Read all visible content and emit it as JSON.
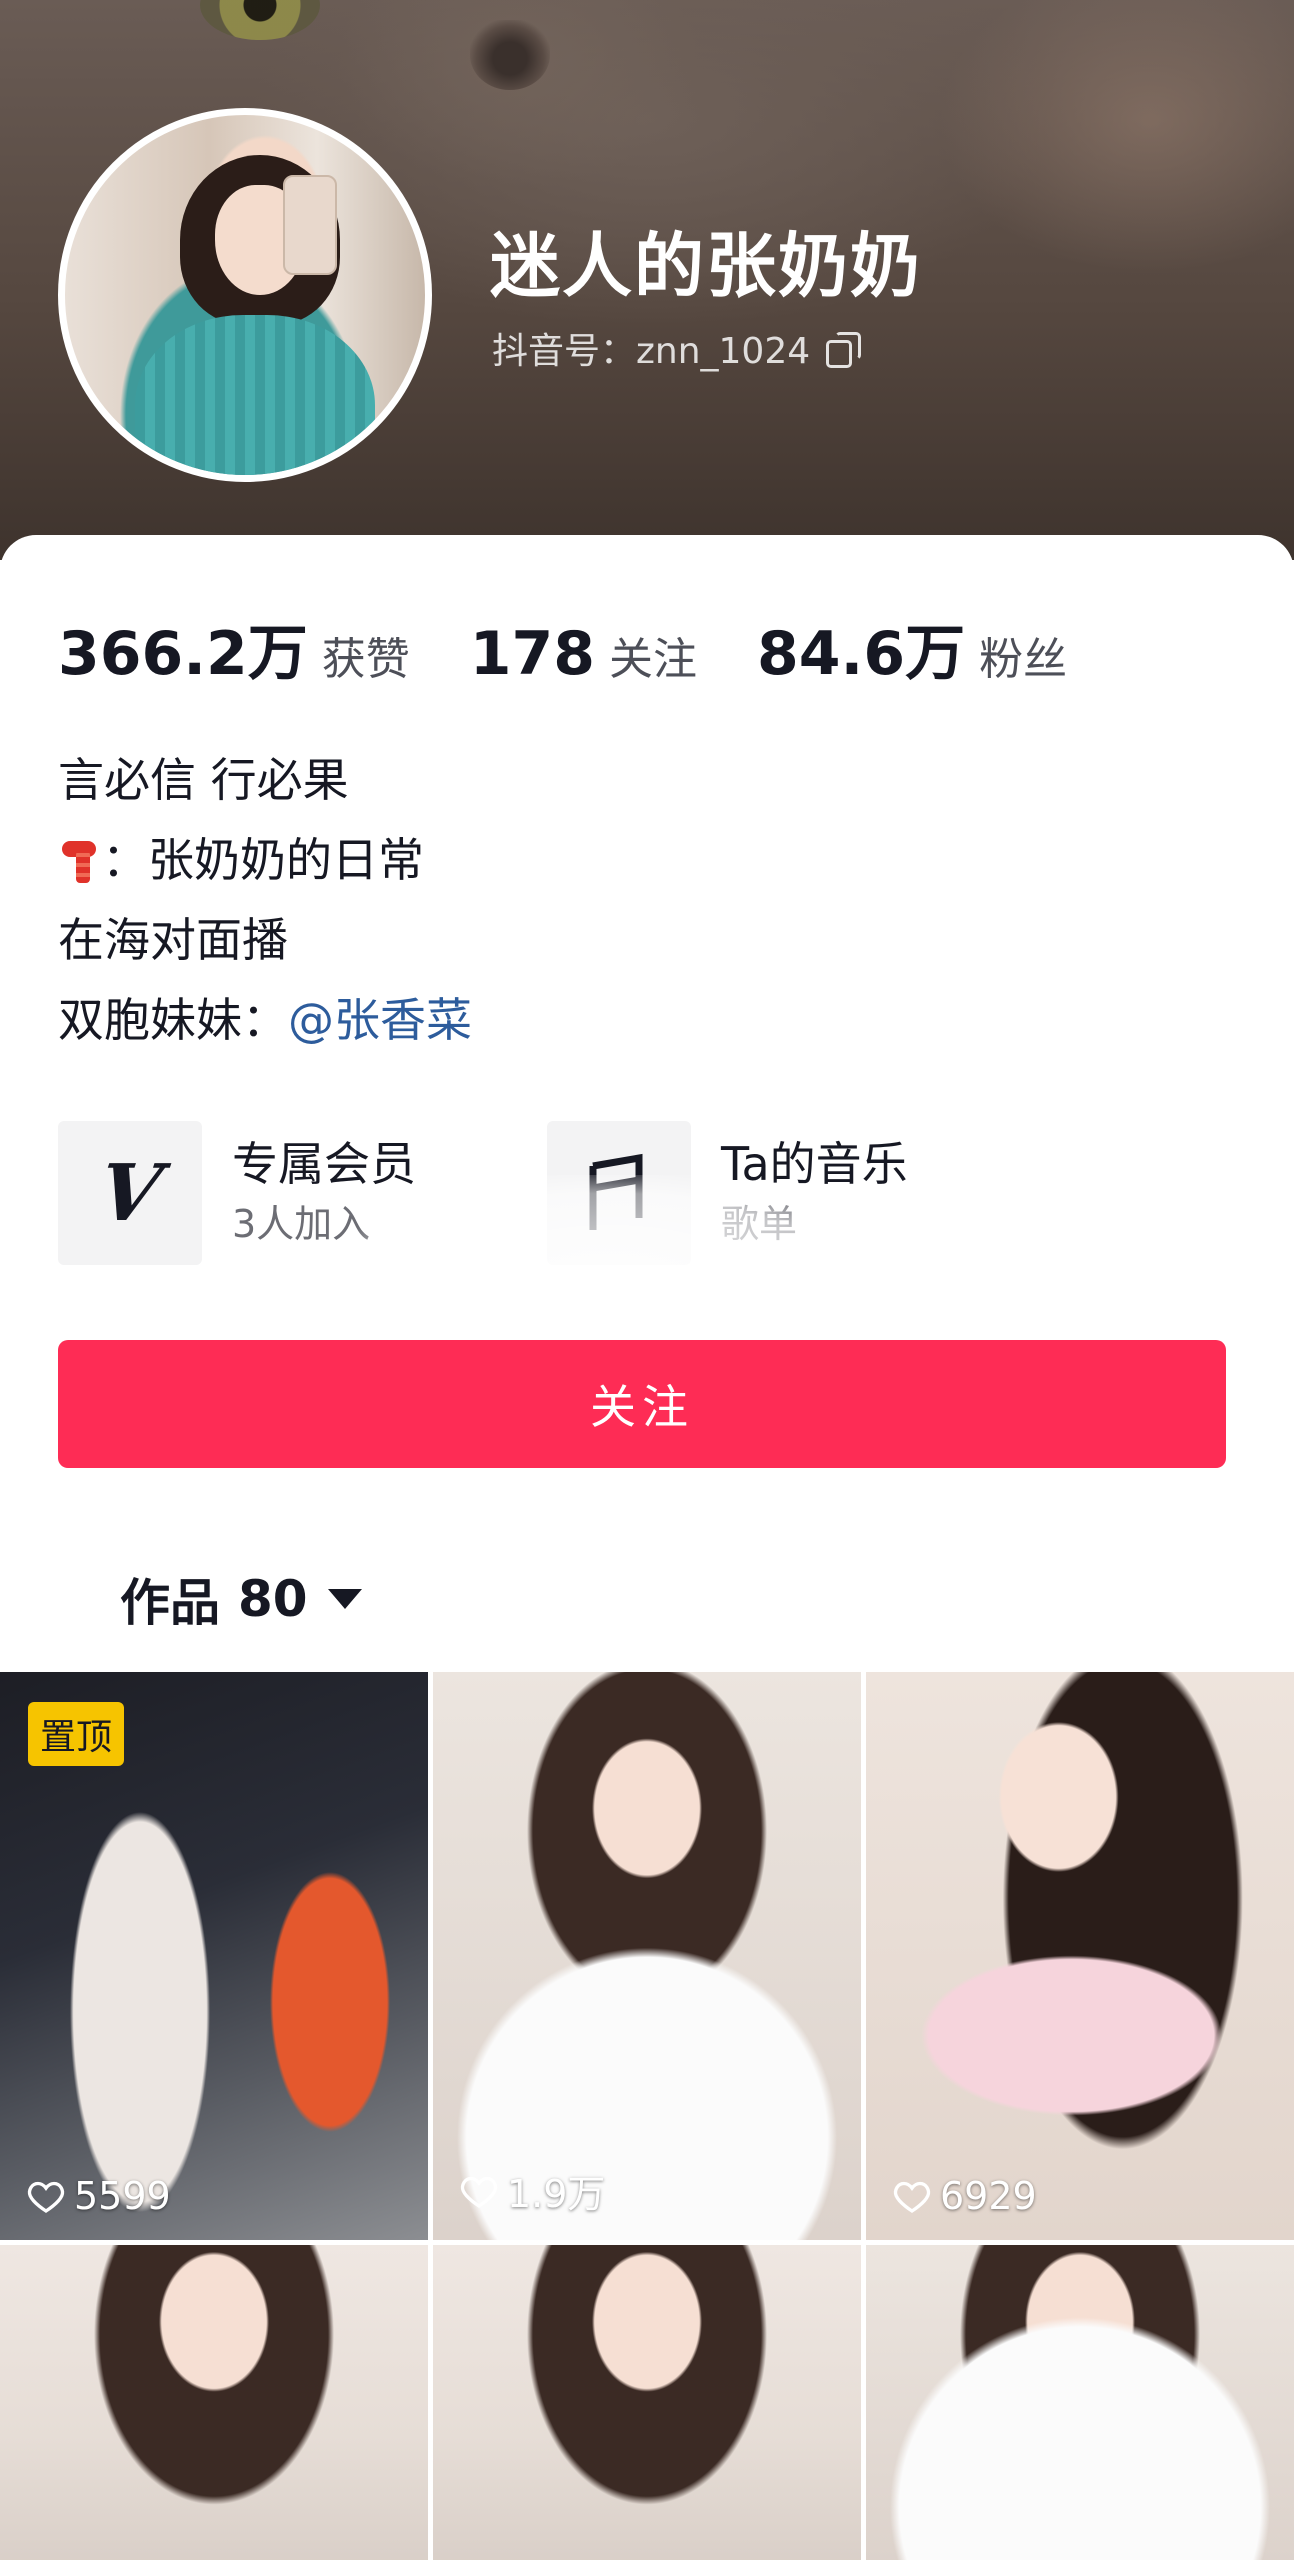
{
  "profile": {
    "name": "迷人的张奶奶",
    "handle": "抖音号：znn_1024"
  },
  "stats": [
    {
      "value": "366.2万",
      "label": "获赞"
    },
    {
      "value": "178",
      "label": "关注"
    },
    {
      "value": "84.6万",
      "label": "粉丝"
    }
  ],
  "bio": {
    "line1": "言必信 行必果",
    "line2": "：张奶奶的日常",
    "line3": "在海对面播",
    "line4_prefix": "双胞妹妹：",
    "line4_mention": "@张香菜"
  },
  "features": {
    "member_title": "专属会员",
    "member_sub": "3人加入",
    "music_icon": "music-note-icon",
    "music_title": "Ta的音乐",
    "music_sub": "歌单"
  },
  "follow_button": "关注",
  "works": {
    "label": "作品",
    "count": "80"
  },
  "videos": [
    {
      "likes": "5599",
      "pinned": "置顶"
    },
    {
      "likes": "1.9万"
    },
    {
      "likes": "6929"
    }
  ],
  "colors": {
    "accent": "#fe2c55",
    "mention": "#2d5c9c",
    "pin_badge": "#f6c400"
  }
}
